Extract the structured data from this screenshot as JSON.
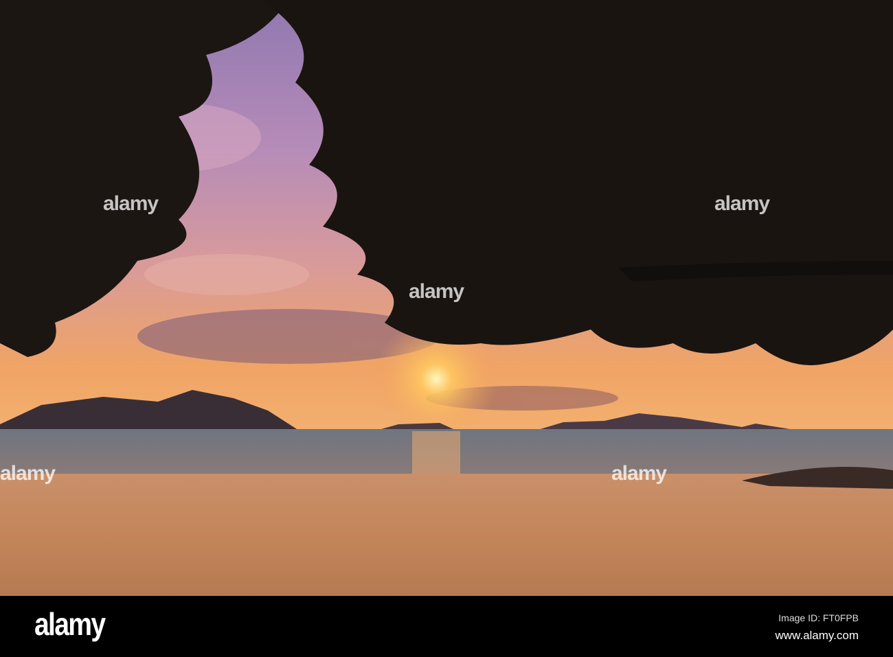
{
  "watermark": {
    "logo": "alamy",
    "image_id": "Image ID: FT0FPB",
    "site": "www.alamy.com"
  },
  "colors": {
    "sky_top": "#9a7fb5",
    "sky_mid": "#c98fa8",
    "horizon": "#f2a65a",
    "sun": "#fff3b0",
    "sea": "#5e6b78",
    "sand": "#c2875a",
    "silhouette": "#1a1410"
  }
}
